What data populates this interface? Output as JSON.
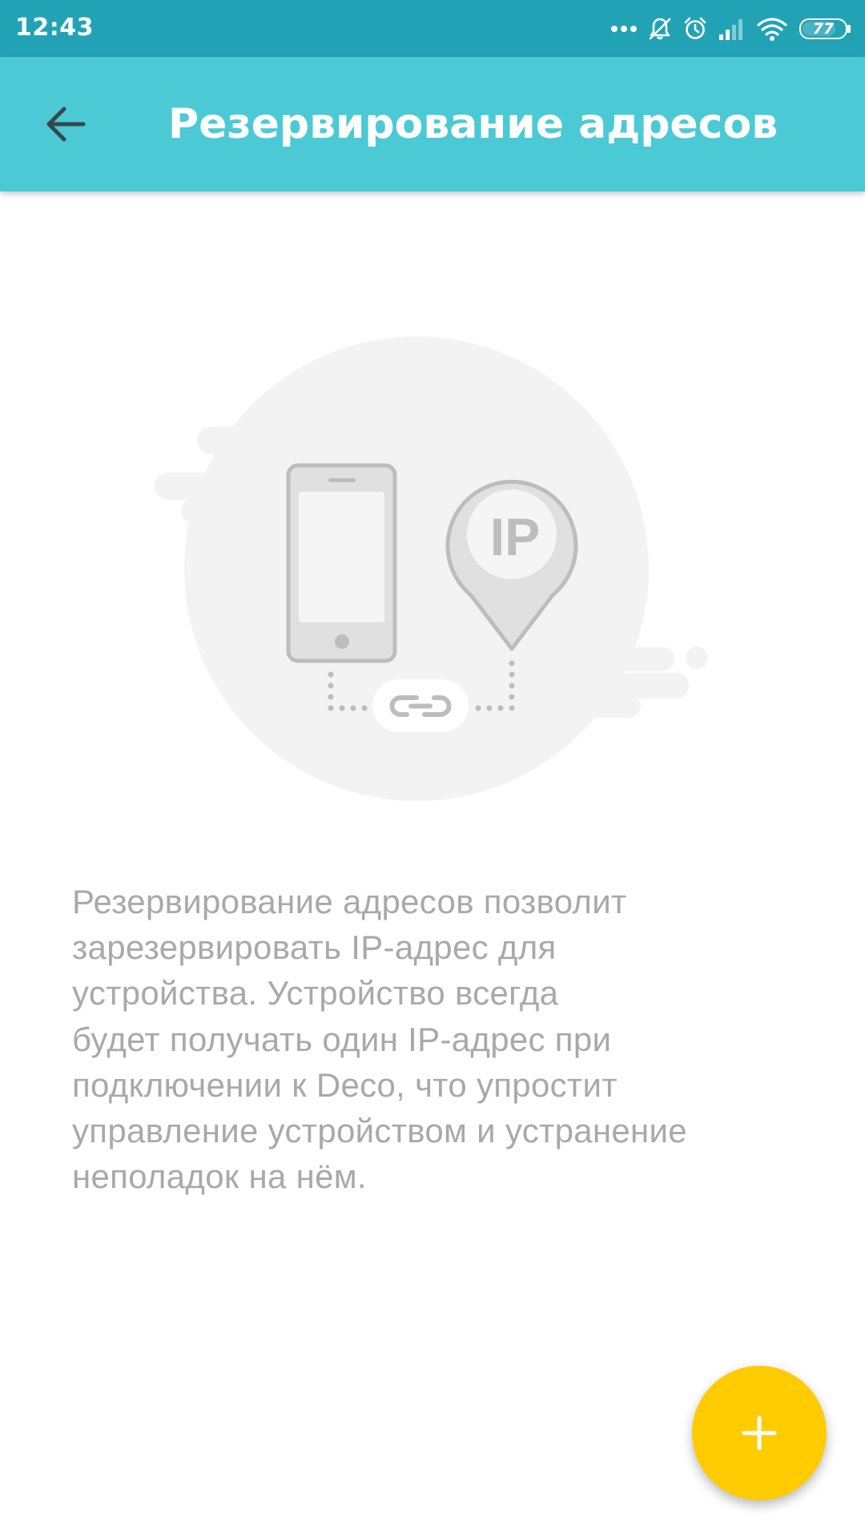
{
  "status_bar": {
    "time": "12:43",
    "icons": [
      "more-dots-icon",
      "silent-bell-icon",
      "alarm-icon",
      "signal-icon",
      "wifi-icon",
      "battery-icon"
    ],
    "battery_level": "77"
  },
  "app_bar": {
    "back_icon": "arrow-back-icon",
    "title": "Резервирование адресов"
  },
  "illustration": {
    "pin_label": "IP",
    "icons": [
      "phone-icon",
      "location-pin-icon",
      "link-icon"
    ]
  },
  "description": {
    "lines": [
      "Резервирование адресов позволит",
      "зарезервировать IP-адрес для",
      "устройства. Устройство всегда",
      "будет получать один IP-адрес при",
      "подключении к Deco, что упростит",
      "управление устройством и устранение",
      "неполадок на нём."
    ]
  },
  "fab": {
    "icon": "plus-icon"
  },
  "colors": {
    "status_bar": "#22a3b5",
    "app_bar": "#4bcad5",
    "fab": "#fecc00",
    "description_text": "#a9a9a9",
    "illustration_bg": "#f3f3f3",
    "illustration_stroke": "#bdbdbd"
  }
}
